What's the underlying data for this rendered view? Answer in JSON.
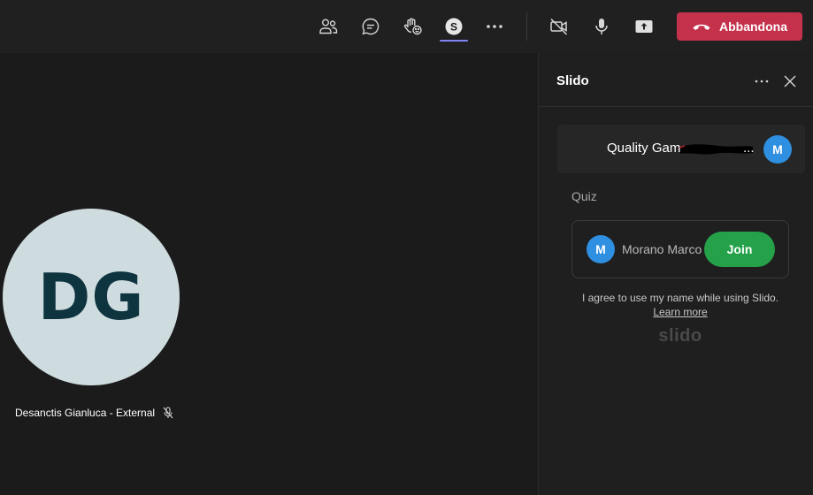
{
  "toolbar": {
    "buttons": [
      {
        "icon": "people-icon",
        "label": "Participants"
      },
      {
        "icon": "chat-icon",
        "label": "Chat"
      },
      {
        "icon": "raise-hand-icon",
        "label": "Reactions"
      },
      {
        "icon": "slido-app-icon",
        "label": "Slido",
        "active": true
      },
      {
        "icon": "more-icon",
        "label": "More"
      },
      {
        "icon": "camera-off-icon",
        "label": "Camera"
      },
      {
        "icon": "microphone-icon",
        "label": "Mic"
      },
      {
        "icon": "share-icon",
        "label": "Share"
      }
    ],
    "slido_letter": "S",
    "leave_label": "Abbandona",
    "leave_color": "#c4314b",
    "accent_color": "#7f85f5"
  },
  "stage": {
    "participant": {
      "initials": "DG",
      "name": "Desanctis Gianluca - External",
      "muted": true,
      "avatar_color": "#cfdcdf",
      "initials_color": "#0e3440"
    }
  },
  "panel": {
    "title": "Slido",
    "event": {
      "title_visible": "Quality Gam",
      "ellipsis": "...",
      "redacted": true,
      "avatar_initial": "M"
    },
    "quiz_label": "Quiz",
    "join_card": {
      "avatar_initial": "M",
      "name": "Morano Marco",
      "join_label": "Join",
      "join_color": "#24a149"
    },
    "consent_text": "I agree to use my name while using Slido.",
    "learn_more": "Learn more",
    "logo": "slido"
  }
}
